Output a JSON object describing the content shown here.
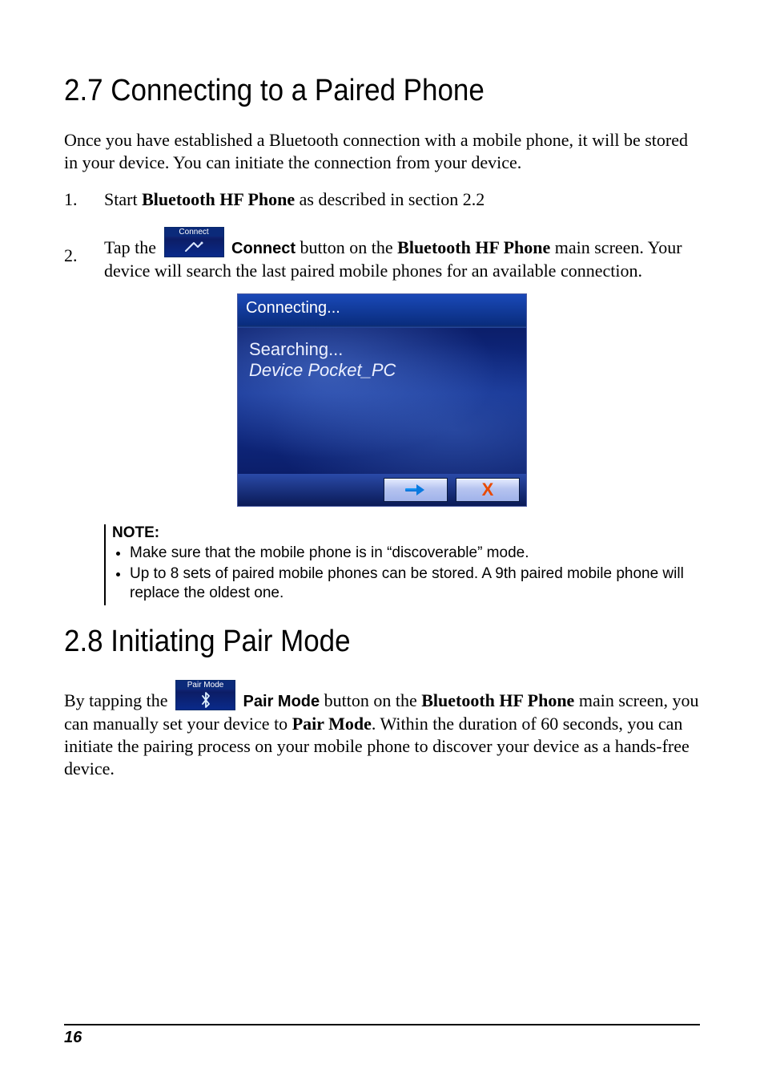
{
  "section27": {
    "heading": "2.7   Connecting to a Paired Phone",
    "intro": "Once you have established a Bluetooth connection with a mobile phone, it will be stored in your device. You can initiate the connection from your device.",
    "step1_num": "1.",
    "step1_prefix": "Start ",
    "step1_bold": "Bluetooth HF Phone",
    "step1_suffix": " as described in section 2.2",
    "step2_num": "2.",
    "step2_prefix": "Tap the ",
    "connect_btn_caption": "Connect",
    "step2_label": "Connect",
    "step2_mid1": " button on the ",
    "step2_bold2": "Bluetooth HF Phone",
    "step2_mid2": " main screen. Your device will search the last paired mobile phones for an available connection."
  },
  "device_dialog": {
    "title": "Connecting...",
    "line1": "Searching...",
    "line2": "Device Pocket_PC"
  },
  "note": {
    "title": "NOTE:",
    "items": [
      "Make sure that the mobile phone is in “discoverable” mode.",
      "Up to 8 sets of paired mobile phones can be stored. A 9th paired mobile phone will replace the oldest one."
    ]
  },
  "section28": {
    "heading": "2.8   Initiating Pair Mode",
    "prefix": "By tapping the",
    "pairmode_btn_caption": "Pair Mode",
    "label": "Pair Mode",
    "mid1": " button on the ",
    "bold1": "Bluetooth HF Phone",
    "mid2": " main screen, you can manually set your device to ",
    "bold2": "Pair Mode",
    "suffix": ". Within the duration of 60 seconds, you can initiate the pairing process on your mobile phone to discover your device as a hands-free device."
  },
  "page_number": "16"
}
